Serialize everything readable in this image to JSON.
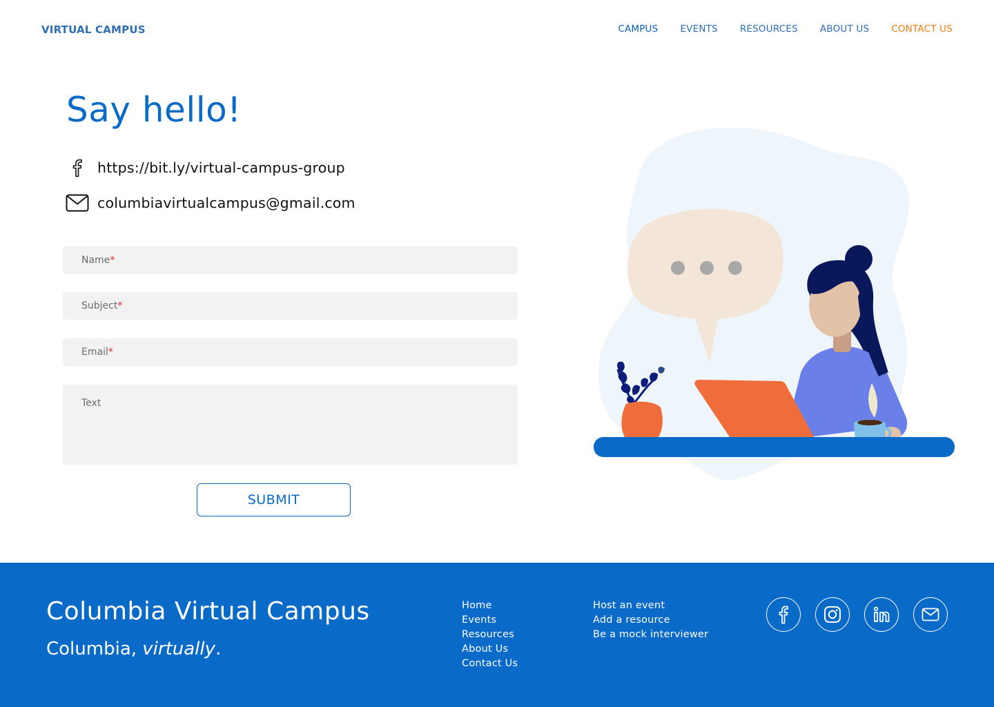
{
  "header": {
    "brand": "VIRTUAL CAMPUS",
    "nav": [
      "CAMPUS",
      "EVENTS",
      "RESOURCES",
      "ABOUT US",
      "CONTACT US"
    ]
  },
  "main": {
    "title": "Say hello!",
    "facebook_link": "https://bit.ly/virtual-campus-group",
    "email": "columbiavirtualcampus@gmail.com",
    "form": {
      "name_placeholder": "Name",
      "subject_placeholder": "Subject",
      "email_placeholder": "Email",
      "required_mark": "*",
      "text_placeholder": "Text",
      "submit_label": "SUBMIT"
    }
  },
  "footer": {
    "title": "Columbia Virtual Campus",
    "tagline_prefix": "Columbia, ",
    "tagline_emphasis": "virtually",
    "tagline_suffix": ".",
    "links_col1": [
      "Home",
      "Events",
      "Resources",
      "About Us",
      "Contact Us"
    ],
    "links_col2": [
      "Host an event",
      "Add a resource",
      "Be a mock interviewer"
    ],
    "social_icons": [
      "facebook-icon",
      "instagram-icon",
      "linkedin-icon",
      "mail-icon"
    ]
  },
  "colors": {
    "primary": "#0a6ac8",
    "nav": "#2f6db5",
    "accent_orange": "#f07c18",
    "required": "#e02424",
    "field_bg": "#f2f2f2"
  }
}
